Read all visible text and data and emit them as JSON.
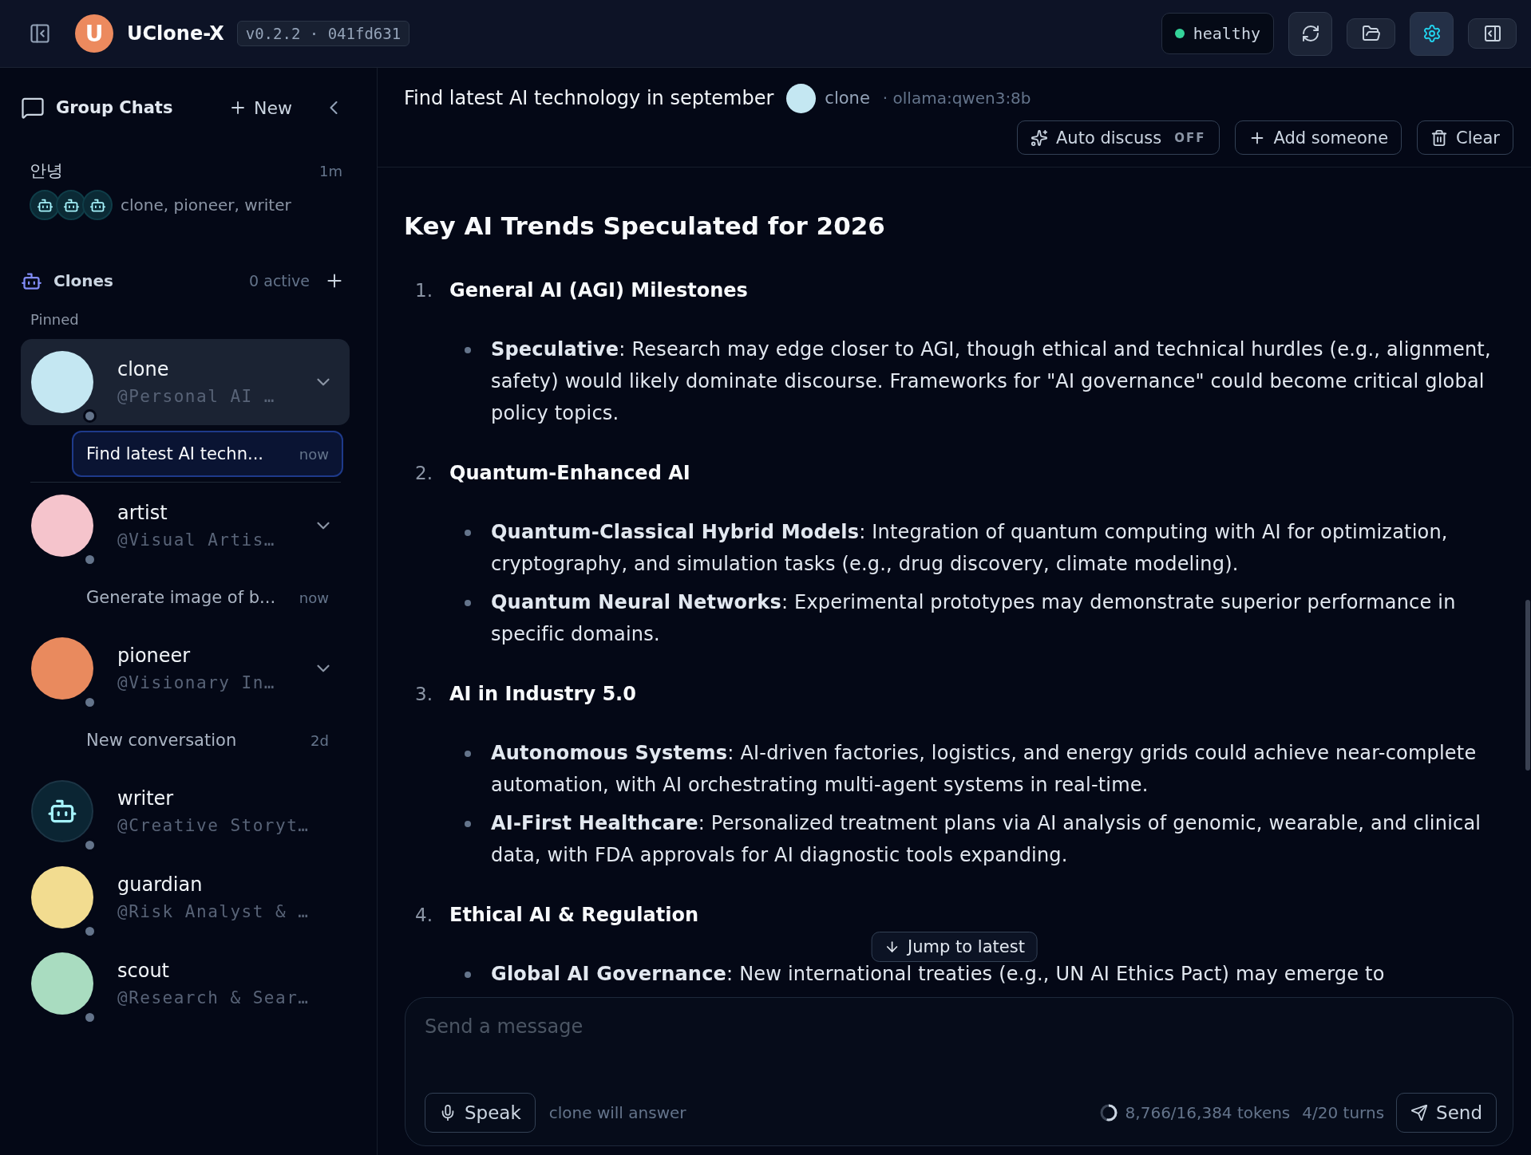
{
  "top_bar": {
    "logo_letter": "U",
    "app_name": "UClone-X",
    "version": "v0.2.2 · 041fd631",
    "health": {
      "label": "healthy",
      "ok": true
    },
    "tools": [
      {
        "kind": "refresh",
        "active": false
      },
      {
        "kind": "folder",
        "active": false
      },
      {
        "kind": "settings",
        "active": true
      },
      {
        "kind": "panel",
        "active": false
      }
    ]
  },
  "sidebar": {
    "group_chats": {
      "title": "Group Chats",
      "new_label": "New",
      "items": [
        {
          "name": "안녕",
          "time": "1m",
          "avatars": [
            {
              "kind": "bot"
            },
            {
              "kind": "bot"
            },
            {
              "kind": "bot"
            }
          ],
          "members": "clone, pioneer, writer",
          "selected": false
        }
      ]
    },
    "clones": {
      "title": "Clones",
      "active_count": "0 active",
      "pinned_label": "Pinned",
      "pinned": [
        {
          "name": "clone",
          "handle": "@Personal AI …",
          "avatar": {
            "kind": "photo",
            "color": "#c4e7f2"
          },
          "online": false,
          "selected": true,
          "expanded": true,
          "chats": [
            {
              "title": "Find latest AI techn...",
              "time": "now",
              "selected": true
            }
          ]
        }
      ],
      "others": [
        {
          "name": "artist",
          "handle": "@Visual Artis…",
          "avatar": {
            "kind": "photo",
            "color": "#f5c4cc"
          },
          "online": false,
          "selected": false,
          "expanded": true,
          "chats": [
            {
              "title": "Generate image of b...",
              "time": "now",
              "selected": false
            }
          ]
        },
        {
          "name": "pioneer",
          "handle": "@Visionary In…",
          "avatar": {
            "kind": "photo",
            "color": "#e98a5e"
          },
          "online": false,
          "selected": false,
          "expanded": true,
          "chats": [
            {
              "title": "New conversation",
              "time": "2d",
              "selected": false
            }
          ]
        },
        {
          "name": "writer",
          "handle": "@Creative Storyt…",
          "avatar": {
            "kind": "bot"
          },
          "online": false,
          "selected": false
        },
        {
          "name": "guardian",
          "handle": "@Risk Analyst & …",
          "avatar": {
            "kind": "photo",
            "color": "#f2dc90"
          },
          "online": false,
          "selected": false
        },
        {
          "name": "scout",
          "handle": "@Research & Sear…",
          "avatar": {
            "kind": "photo",
            "color": "#a9dcc0"
          },
          "online": false,
          "selected": false
        }
      ]
    }
  },
  "chat": {
    "title": "Find latest AI technology in september",
    "agent": {
      "name": "clone",
      "avatar": {
        "kind": "photo",
        "color": "#c4e7f2"
      }
    },
    "model": "· ollama:qwen3:8b",
    "actions": [
      {
        "kind": "auto",
        "label": "Auto discuss",
        "state": "OFF",
        "on": false
      },
      {
        "kind": "add",
        "label": "Add someone"
      },
      {
        "kind": "clear",
        "label": "Clear"
      }
    ],
    "message": {
      "heading": "Key AI Trends Speculated for 2026",
      "sections": [
        {
          "number": "1.",
          "title": "General AI (AGI) Milestones",
          "bullets": [
            "**Speculative**: Research may edge closer to AGI, though ethical and technical hurdles (e.g., alignment, safety) would likely dominate discourse. Frameworks for \"AI governance\" could become critical global policy topics."
          ]
        },
        {
          "number": "2.",
          "title": "Quantum-Enhanced AI",
          "bullets": [
            "**Quantum-Classical Hybrid Models**: Integration of quantum computing with AI for optimization, cryptography, and simulation tasks (e.g., drug discovery, climate modeling).",
            "**Quantum Neural Networks**: Experimental prototypes may demonstrate superior performance in specific domains."
          ]
        },
        {
          "number": "3.",
          "title": "AI in Industry 5.0",
          "bullets": [
            "**Autonomous Systems**: AI-driven factories, logistics, and energy grids could achieve near-complete automation, with AI orchestrating multi-agent systems in real-time.",
            "**AI-First Healthcare**: Personalized treatment plans via AI analysis of genomic, wearable, and clinical data, with FDA approvals for AI diagnostic tools expanding."
          ]
        },
        {
          "number": "4.",
          "title": "Ethical AI & Regulation",
          "bullets": [
            "**Global AI Governance**: New international treaties (e.g., UN AI Ethics Pact) may emerge to"
          ]
        }
      ]
    },
    "jump_label": "Jump to latest",
    "composer": {
      "placeholder": "Send a message",
      "speak_label": "Speak",
      "responder": "clone will answer",
      "tokens": {
        "label": "8,766/16,384 tokens",
        "level": 0.54
      },
      "turns": "4/20 turns",
      "send_label": "Send"
    }
  }
}
